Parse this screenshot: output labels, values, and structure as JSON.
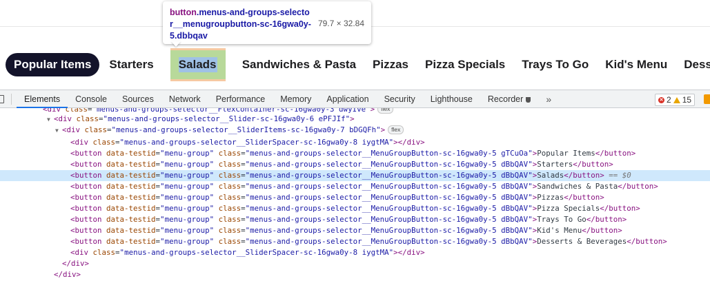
{
  "menu": {
    "items": [
      {
        "label": "Popular Items"
      },
      {
        "label": "Starters"
      },
      {
        "label": "Salads"
      },
      {
        "label": "Sandwiches & Pasta"
      },
      {
        "label": "Pizzas"
      },
      {
        "label": "Pizza Specials"
      },
      {
        "label": "Trays To Go"
      },
      {
        "label": "Kid's Menu"
      },
      {
        "label": "Dessert"
      }
    ]
  },
  "tooltip": {
    "tag": "button",
    "class_text": ".menus-and-groups-selector__menugroupbutton-sc-16gwa0y-5.dbbqav",
    "size": "79.7 × 32.84"
  },
  "devtools": {
    "tabs": [
      "Elements",
      "Console",
      "Sources",
      "Network",
      "Performance",
      "Memory",
      "Application",
      "Security",
      "Lighthouse",
      "Recorder"
    ],
    "more": "»",
    "errors": "2",
    "warnings": "15"
  },
  "tree": {
    "lines": [
      {
        "indent": "<div class=\"menus-and-groups-selector__FlexContainer-sc-16gwa0y-3 dwyIve\">",
        "badge": "flex"
      },
      {
        "open": "div",
        "class": "menus-and-groups-selector__Slider-sc-16gwa0y-6 ePFJIf"
      },
      {
        "open": "div",
        "class": "menus-and-groups-selector__SliderItems-sc-16gwa0y-7 bDGQFh",
        "badge": "flex"
      },
      {
        "div": "div",
        "class": "menus-and-groups-selector__SliderSpacer-sc-16gwa0y-8 iygtMA"
      },
      {
        "btn_class": "menus-and-groups-selector__MenuGroupButton-sc-16gwa0y-5 gTCuOa",
        "text": "Popular Items"
      },
      {
        "btn_class": "menus-and-groups-selector__MenuGroupButton-sc-16gwa0y-5 dBbQAV",
        "text": "Starters"
      },
      {
        "btn_class": "menus-and-groups-selector__MenuGroupButton-sc-16gwa0y-5 dBbQAV",
        "text": "Salads",
        "selected_marker": "== $0"
      },
      {
        "btn_class": "menus-and-groups-selector__MenuGroupButton-sc-16gwa0y-5 dBbQAV",
        "text": "Sandwiches & Pasta"
      },
      {
        "btn_class": "menus-and-groups-selector__MenuGroupButton-sc-16gwa0y-5 dBbQAV",
        "text": "Pizzas"
      },
      {
        "btn_class": "menus-and-groups-selector__MenuGroupButton-sc-16gwa0y-5 dBbQAV",
        "text": "Pizza Specials"
      },
      {
        "btn_class": "menus-and-groups-selector__MenuGroupButton-sc-16gwa0y-5 dBbQAV",
        "text": "Trays To Go"
      },
      {
        "btn_class": "menus-and-groups-selector__MenuGroupButton-sc-16gwa0y-5 dBbQAV",
        "text": "Kid's Menu"
      },
      {
        "btn_class": "menus-and-groups-selector__MenuGroupButton-sc-16gwa0y-5 dBbQAV",
        "text": "Desserts & Beverages"
      },
      {
        "div": "div",
        "class": "menus-and-groups-selector__SliderSpacer-sc-16gwa0y-8 iygtMA"
      },
      {
        "close": "div"
      },
      {
        "close": "div"
      }
    ],
    "testid_attr": "data-testid",
    "testid_val": "menu-group"
  }
}
